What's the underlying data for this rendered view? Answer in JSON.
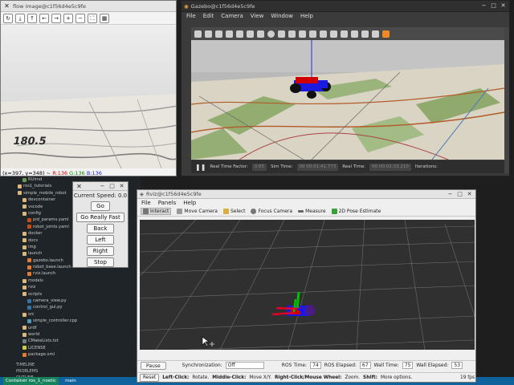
{
  "image_view": {
    "title": "flow image@c1f56d4e5c9fe",
    "status": "(x=397, y=348) ~ R:136 G:136 B:136",
    "image_text": "180.5",
    "toolbar_icons": [
      "refresh-icon",
      "save-icon",
      "arrow-up-icon",
      "arrow-left-icon",
      "arrow-right-icon",
      "zoom-in-icon",
      "zoom-out-icon",
      "fit-icon",
      "grid-icon"
    ]
  },
  "gazebo": {
    "title": "Gazebo@c1f56d4e5c9fe",
    "menu": [
      "File",
      "Edit",
      "Camera",
      "View",
      "Window",
      "Help"
    ],
    "real_time_factor_label": "Real Time Factor:",
    "real_time_factor": "0.65",
    "sim_time_label": "Sim Time:",
    "sim_time": "00 00:01:41.773",
    "real_time_label": "Real Time:",
    "real_time": "00 00:02:33.210",
    "iterations_label": "Iterations:"
  },
  "teleop": {
    "current_speed": "Current Speed: 0.0",
    "buttons": [
      "Go",
      "Go Really Fast",
      "Back",
      "Left",
      "Right",
      "Stop"
    ]
  },
  "rviz": {
    "title": "Rviz@c1f56d4e5c9fe",
    "menu": [
      "File",
      "Panels",
      "Help"
    ],
    "tools": [
      "Interact",
      "Move Camera",
      "Select",
      "Focus Camera",
      "Measure",
      "2D Pose Estimate"
    ],
    "pause_label": "Pause",
    "sync_label": "Synchronization:",
    "sync_value": "Off",
    "ros_time_label": "ROS Time:",
    "ros_time": "74",
    "ros_elapsed_label": "ROS Elapsed:",
    "ros_elapsed": "67",
    "wall_time_label": "Wall Time:",
    "wall_time": "75",
    "wall_elapsed_label": "Wall Elapsed:",
    "wall_elapsed": "53",
    "reset_label": "Reset",
    "hint_left": "Left-Click:",
    "hint_left_text": "Rotate.",
    "hint_middle": "Middle-Click:",
    "hint_middle_text": "Move X/Y.",
    "hint_right": "Right-Click/Mouse Wheel:",
    "hint_right_text": "Zoom.",
    "hint_shift": "Shift:",
    "hint_shift_text": "More options.",
    "fps": "19 fps"
  },
  "explorer": {
    "rows": [
      {
        "label": "RUlmd",
        "color": "#6a9955"
      },
      {
        "label": "ros1_tutorials",
        "color": "#dcb67a"
      },
      {
        "label": "simple_mobile_robot",
        "color": "#dcb67a"
      },
      {
        "label": "devcontainer",
        "color": "#dcb67a"
      },
      {
        "label": "vscode",
        "color": "#dcb67a"
      },
      {
        "label": "config",
        "color": "#dcb67a"
      },
      {
        "label": "pid_params.yaml",
        "color": "#cb4b16"
      },
      {
        "label": "robot_joints.yaml",
        "color": "#cb4b16"
      },
      {
        "label": "docker",
        "color": "#dcb67a"
      },
      {
        "label": "docs",
        "color": "#dcb67a"
      },
      {
        "label": "img",
        "color": "#dcb67a"
      },
      {
        "label": "launch",
        "color": "#dcb67a"
      },
      {
        "label": "gazebo.launch",
        "color": "#e37933"
      },
      {
        "label": "robot_base.launch",
        "color": "#e37933"
      },
      {
        "label": "rviz.launch",
        "color": "#e37933"
      },
      {
        "label": "models",
        "color": "#dcb67a"
      },
      {
        "label": "rviz",
        "color": "#dcb67a"
      },
      {
        "label": "scripts",
        "color": "#dcb67a"
      },
      {
        "label": "camera_view.py",
        "color": "#3572a5"
      },
      {
        "label": "control_gui.py",
        "color": "#3572a5"
      },
      {
        "label": "src",
        "color": "#dcb67a"
      },
      {
        "label": "simple_controller.cpp",
        "color": "#519aba"
      },
      {
        "label": "urdf",
        "color": "#dcb67a"
      },
      {
        "label": "world",
        "color": "#dcb67a"
      },
      {
        "label": "CMakeLists.txt",
        "color": "#6d8086"
      },
      {
        "label": "LICENSE",
        "color": "#cbcb41"
      },
      {
        "label": "package.xml",
        "color": "#e37933"
      }
    ],
    "footer": [
      "TIMELINE",
      "PROBLEMS",
      "OUTLINE"
    ]
  },
  "statusbar": {
    "remote": "Container ros_1_noetic",
    "branch": "main"
  },
  "colors": {
    "rviz_background": "#303030",
    "axis_red": "#e0002a",
    "axis_green": "#00c000",
    "axis_blue": "#1010ff",
    "robot_red": "#d00000",
    "robot_blue": "#1a1ae0"
  }
}
